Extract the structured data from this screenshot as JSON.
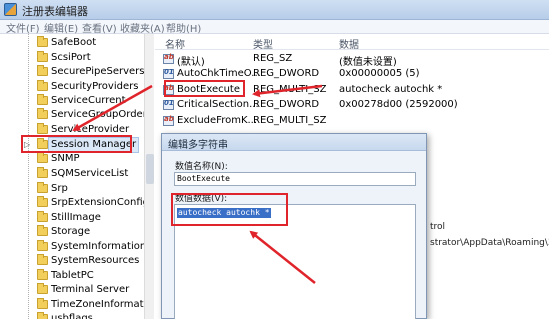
{
  "window": {
    "title": "注册表编辑器"
  },
  "menu": [
    "文件(F)",
    "编辑(E)",
    "查看(V)",
    "收藏夹(A)",
    "帮助(H)"
  ],
  "tree": {
    "items": [
      {
        "label": "SafeBoot"
      },
      {
        "label": "ScsiPort"
      },
      {
        "label": "SecurePipeServers"
      },
      {
        "label": "SecurityProviders"
      },
      {
        "label": "ServiceCurrent"
      },
      {
        "label": "ServiceGroupOrder"
      },
      {
        "label": "ServiceProvider"
      },
      {
        "label": "Session Manager",
        "selected": true,
        "expandable": true
      },
      {
        "label": "SNMP"
      },
      {
        "label": "SQMServiceList"
      },
      {
        "label": "Srp"
      },
      {
        "label": "SrpExtensionConfig"
      },
      {
        "label": "StillImage"
      },
      {
        "label": "Storage"
      },
      {
        "label": "SystemInformation"
      },
      {
        "label": "SystemResources"
      },
      {
        "label": "TabletPC"
      },
      {
        "label": "Terminal Server"
      },
      {
        "label": "TimeZoneInformation"
      },
      {
        "label": "usbflags"
      }
    ]
  },
  "list": {
    "columns": {
      "name": "名称",
      "type": "类型",
      "data": "数据"
    },
    "rows": [
      {
        "icon": "string-value-icon",
        "name": "(默认)",
        "type": "REG_SZ",
        "data": "(数值未设置)"
      },
      {
        "icon": "binary-value-icon",
        "name": "AutoChkTimeO...",
        "type": "REG_DWORD",
        "data": "0x00000005 (5)"
      },
      {
        "icon": "string-value-icon",
        "name": "BootExecute",
        "type": "REG_MULTI_SZ",
        "data": "autocheck autochk *"
      },
      {
        "icon": "binary-value-icon",
        "name": "CriticalSection...",
        "type": "REG_DWORD",
        "data": "0x00278d00 (2592000)"
      },
      {
        "icon": "string-value-icon",
        "name": "ExcludeFromK...",
        "type": "REG_MULTI_SZ",
        "data": ""
      }
    ],
    "peek": {
      "trol": "trol",
      "path": "strator\\AppData\\Roaming\\3"
    }
  },
  "dialog": {
    "title": "编辑多字符串",
    "name_label": "数值名称(N):",
    "name_value": "BootExecute",
    "data_label": "数值数据(V):",
    "data_value": "autocheck autochk *"
  },
  "colors": {
    "annotation_red": "#e0242b",
    "selection_blue": "#3a6fc7"
  }
}
